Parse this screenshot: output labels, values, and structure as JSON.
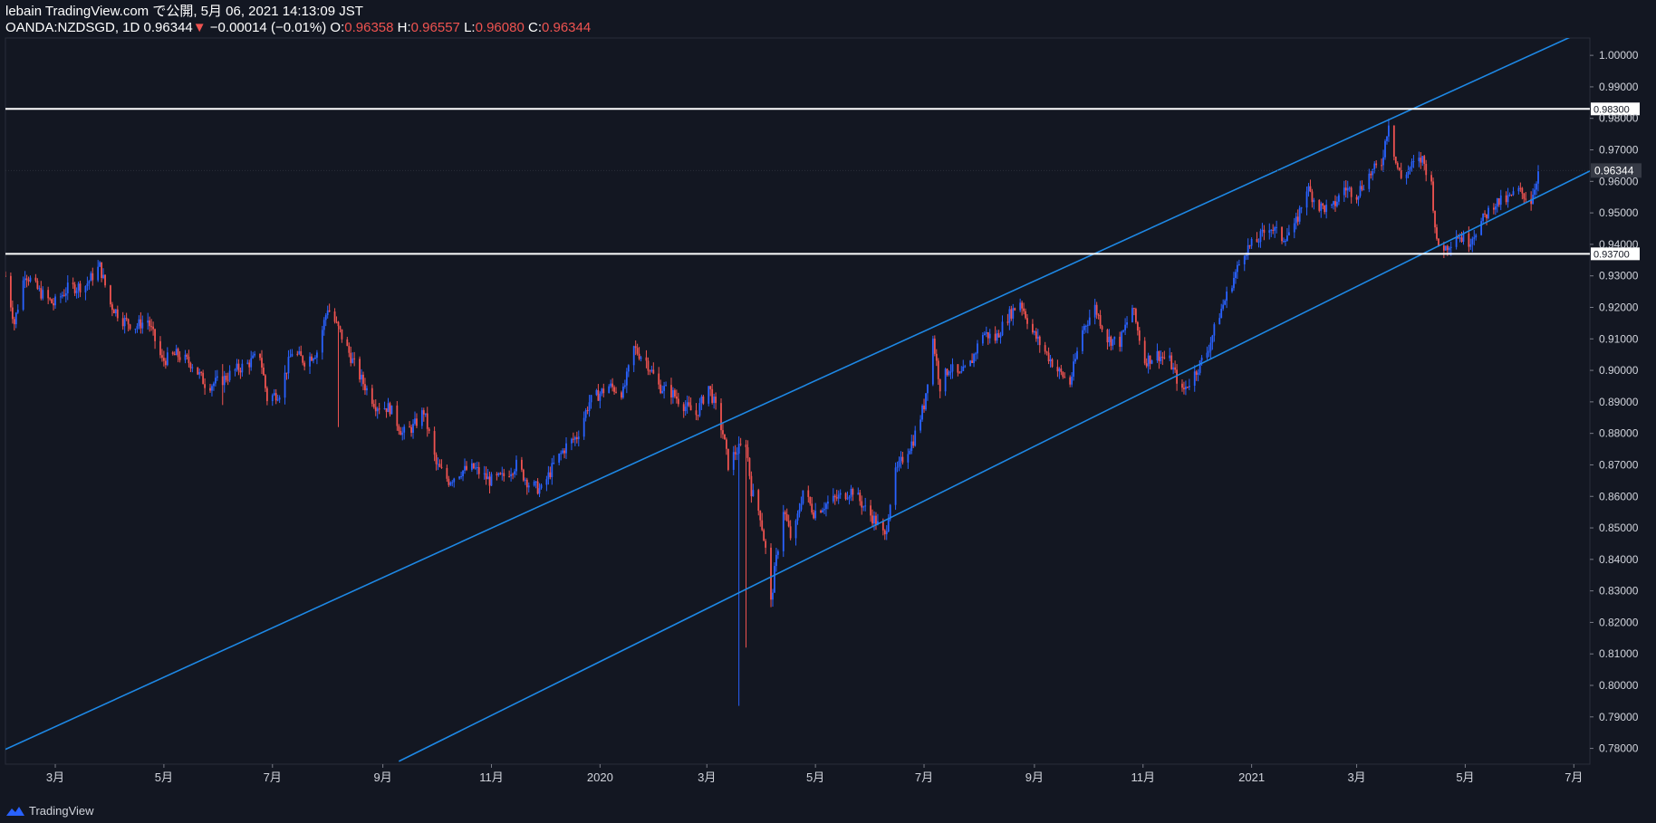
{
  "header": {
    "title": "lebain TradingView.com で公開, 5月 06, 2021 14:13:09 JST",
    "symbol": "OANDA:NZDSGD, 1D",
    "last": "0.96344",
    "change_arrow": "▼",
    "change": "−0.00014 (−0.01%)",
    "o_label": "O:",
    "o_value": "0.96358",
    "h_label": "H:",
    "h_value": "0.96557",
    "l_label": "L:",
    "l_value": "0.96080",
    "c_label": "C:",
    "c_value": "0.96344"
  },
  "footer": {
    "brand": "TradingView"
  },
  "colors": {
    "background": "#131722",
    "up": "#2962ff",
    "down": "#ef5350",
    "channel": "#1e88e5",
    "hline": "#ffffff",
    "axis_text": "#d1d4dc"
  },
  "chart_data": {
    "type": "candlestick",
    "symbol": "OANDA:NZDSGD",
    "timeframe": "1D",
    "ylim": [
      0.775,
      1.0055
    ],
    "y_ticks": [
      "1.00000",
      "0.99000",
      "0.98000",
      "0.97000",
      "0.96000",
      "0.95000",
      "0.94000",
      "0.93000",
      "0.92000",
      "0.91000",
      "0.90000",
      "0.89000",
      "0.88000",
      "0.87000",
      "0.86000",
      "0.85000",
      "0.84000",
      "0.83000",
      "0.82000",
      "0.81000",
      "0.80000",
      "0.79000",
      "0.78000"
    ],
    "x_ticks": [
      "3月",
      "5月",
      "7月",
      "9月",
      "11月",
      "2020",
      "3月",
      "5月",
      "7月",
      "9月",
      "11月",
      "2021",
      "3月",
      "5月",
      "7月"
    ],
    "x_start": "2019-02-01",
    "x_end": "2021-07-10",
    "x_tick_dates": [
      "2019-03-01",
      "2019-05-01",
      "2019-07-01",
      "2019-09-01",
      "2019-11-01",
      "2020-01-01",
      "2020-03-01",
      "2020-05-01",
      "2020-07-01",
      "2020-09-01",
      "2020-11-01",
      "2021-01-01",
      "2021-03-01",
      "2021-05-01",
      "2021-07-01"
    ],
    "price_levels": [
      {
        "value": 0.983,
        "label": "0.98300"
      },
      {
        "value": 0.937,
        "label": "0.93700"
      }
    ],
    "last_price": {
      "value": 0.96344,
      "label": "0.96344"
    },
    "channel_lines": [
      {
        "name": "upper",
        "from": {
          "date": "2019-02-01",
          "value": 0.7797
        },
        "to": {
          "date": "2021-07-01",
          "value": 1.0063
        }
      },
      {
        "name": "lower",
        "from": {
          "date": "2019-09-10",
          "value": 0.7759
        },
        "to": {
          "date": "2021-07-10",
          "value": 0.9633
        }
      }
    ],
    "close_path": [
      [
        "2019-02-01",
        0.93
      ],
      [
        "2019-02-06",
        0.915
      ],
      [
        "2019-02-12",
        0.931
      ],
      [
        "2019-02-20",
        0.925
      ],
      [
        "2019-02-28",
        0.921
      ],
      [
        "2019-03-08",
        0.926
      ],
      [
        "2019-03-18",
        0.927
      ],
      [
        "2019-03-26",
        0.933
      ],
      [
        "2019-04-01",
        0.921
      ],
      [
        "2019-04-08",
        0.916
      ],
      [
        "2019-04-15",
        0.914
      ],
      [
        "2019-04-22",
        0.916
      ],
      [
        "2019-04-30",
        0.903
      ],
      [
        "2019-05-08",
        0.905
      ],
      [
        "2019-05-17",
        0.902
      ],
      [
        "2019-05-25",
        0.895
      ],
      [
        "2019-06-03",
        0.897
      ],
      [
        "2019-06-10",
        0.9
      ],
      [
        "2019-06-17",
        0.902
      ],
      [
        "2019-06-24",
        0.905
      ],
      [
        "2019-06-28",
        0.891
      ],
      [
        "2019-07-05",
        0.893
      ],
      [
        "2019-07-12",
        0.906
      ],
      [
        "2019-07-19",
        0.903
      ],
      [
        "2019-07-26",
        0.906
      ],
      [
        "2019-08-01",
        0.92
      ],
      [
        "2019-08-08",
        0.912
      ],
      [
        "2019-08-15",
        0.903
      ],
      [
        "2019-08-20",
        0.897
      ],
      [
        "2019-08-28",
        0.889
      ],
      [
        "2019-09-05",
        0.888
      ],
      [
        "2019-09-12",
        0.88
      ],
      [
        "2019-09-18",
        0.882
      ],
      [
        "2019-09-24",
        0.887
      ],
      [
        "2019-10-01",
        0.87
      ],
      [
        "2019-10-08",
        0.865
      ],
      [
        "2019-10-15",
        0.868
      ],
      [
        "2019-10-22",
        0.869
      ],
      [
        "2019-10-31",
        0.865
      ],
      [
        "2019-11-07",
        0.866
      ],
      [
        "2019-11-15",
        0.87
      ],
      [
        "2019-11-22",
        0.864
      ],
      [
        "2019-11-29",
        0.862
      ],
      [
        "2019-12-06",
        0.87
      ],
      [
        "2019-12-13",
        0.876
      ],
      [
        "2019-12-19",
        0.879
      ],
      [
        "2019-12-26",
        0.89
      ],
      [
        "2020-01-06",
        0.895
      ],
      [
        "2020-01-14",
        0.893
      ],
      [
        "2020-01-20",
        0.907
      ],
      [
        "2020-01-27",
        0.903
      ],
      [
        "2020-02-03",
        0.895
      ],
      [
        "2020-02-10",
        0.893
      ],
      [
        "2020-02-17",
        0.889
      ],
      [
        "2020-02-24",
        0.886
      ],
      [
        "2020-03-02",
        0.895
      ],
      [
        "2020-03-06",
        0.888
      ],
      [
        "2020-03-10",
        0.88
      ],
      [
        "2020-03-13",
        0.87
      ],
      [
        "2020-03-17",
        0.874
      ],
      [
        "2020-03-23",
        0.877
      ],
      [
        "2020-03-26",
        0.862
      ],
      [
        "2020-03-31",
        0.854
      ],
      [
        "2020-04-03",
        0.843
      ],
      [
        "2020-04-06",
        0.826
      ],
      [
        "2020-04-08",
        0.836
      ],
      [
        "2020-04-13",
        0.856
      ],
      [
        "2020-04-18",
        0.845
      ],
      [
        "2020-04-24",
        0.862
      ],
      [
        "2020-04-30",
        0.855
      ],
      [
        "2020-05-08",
        0.858
      ],
      [
        "2020-05-15",
        0.86
      ],
      [
        "2020-05-22",
        0.862
      ],
      [
        "2020-05-29",
        0.856
      ],
      [
        "2020-06-04",
        0.852
      ],
      [
        "2020-06-09",
        0.847
      ],
      [
        "2020-06-14",
        0.866
      ],
      [
        "2020-06-19",
        0.872
      ],
      [
        "2020-06-25",
        0.878
      ],
      [
        "2020-07-01",
        0.889
      ],
      [
        "2020-07-06",
        0.91
      ],
      [
        "2020-07-10",
        0.895
      ],
      [
        "2020-07-15",
        0.901
      ],
      [
        "2020-07-21",
        0.898
      ],
      [
        "2020-07-27",
        0.902
      ],
      [
        "2020-08-03",
        0.912
      ],
      [
        "2020-08-10",
        0.91
      ],
      [
        "2020-08-17",
        0.917
      ],
      [
        "2020-08-24",
        0.922
      ],
      [
        "2020-08-31",
        0.912
      ],
      [
        "2020-09-07",
        0.906
      ],
      [
        "2020-09-14",
        0.9
      ],
      [
        "2020-09-21",
        0.896
      ],
      [
        "2020-09-28",
        0.913
      ],
      [
        "2020-10-05",
        0.92
      ],
      [
        "2020-10-12",
        0.91
      ],
      [
        "2020-10-19",
        0.909
      ],
      [
        "2020-10-26",
        0.92
      ],
      [
        "2020-11-02",
        0.903
      ],
      [
        "2020-11-09",
        0.905
      ],
      [
        "2020-11-16",
        0.903
      ],
      [
        "2020-11-23",
        0.893
      ],
      [
        "2020-11-30",
        0.899
      ],
      [
        "2020-12-07",
        0.906
      ],
      [
        "2020-12-14",
        0.918
      ],
      [
        "2020-12-21",
        0.928
      ],
      [
        "2020-12-28",
        0.938
      ],
      [
        "2021-01-04",
        0.941
      ],
      [
        "2021-01-11",
        0.946
      ],
      [
        "2021-01-18",
        0.942
      ],
      [
        "2021-01-25",
        0.945
      ],
      [
        "2021-02-01",
        0.958
      ],
      [
        "2021-02-08",
        0.952
      ],
      [
        "2021-02-15",
        0.951
      ],
      [
        "2021-02-22",
        0.958
      ],
      [
        "2021-03-01",
        0.956
      ],
      [
        "2021-03-08",
        0.962
      ],
      [
        "2021-03-15",
        0.966
      ],
      [
        "2021-03-19",
        0.979
      ],
      [
        "2021-03-23",
        0.966
      ],
      [
        "2021-03-26",
        0.961
      ],
      [
        "2021-04-01",
        0.965
      ],
      [
        "2021-04-07",
        0.967
      ],
      [
        "2021-04-12",
        0.959
      ],
      [
        "2021-04-15",
        0.94
      ],
      [
        "2021-04-20",
        0.939
      ],
      [
        "2021-04-26",
        0.943
      ],
      [
        "2021-05-03",
        0.941
      ],
      [
        "2021-05-10",
        0.947
      ],
      [
        "2021-05-17",
        0.953
      ],
      [
        "2021-05-24",
        0.954
      ],
      [
        "2021-05-31",
        0.957
      ],
      [
        "2021-06-07",
        0.954
      ],
      [
        "2021-06-11",
        0.963
      ]
    ]
  }
}
